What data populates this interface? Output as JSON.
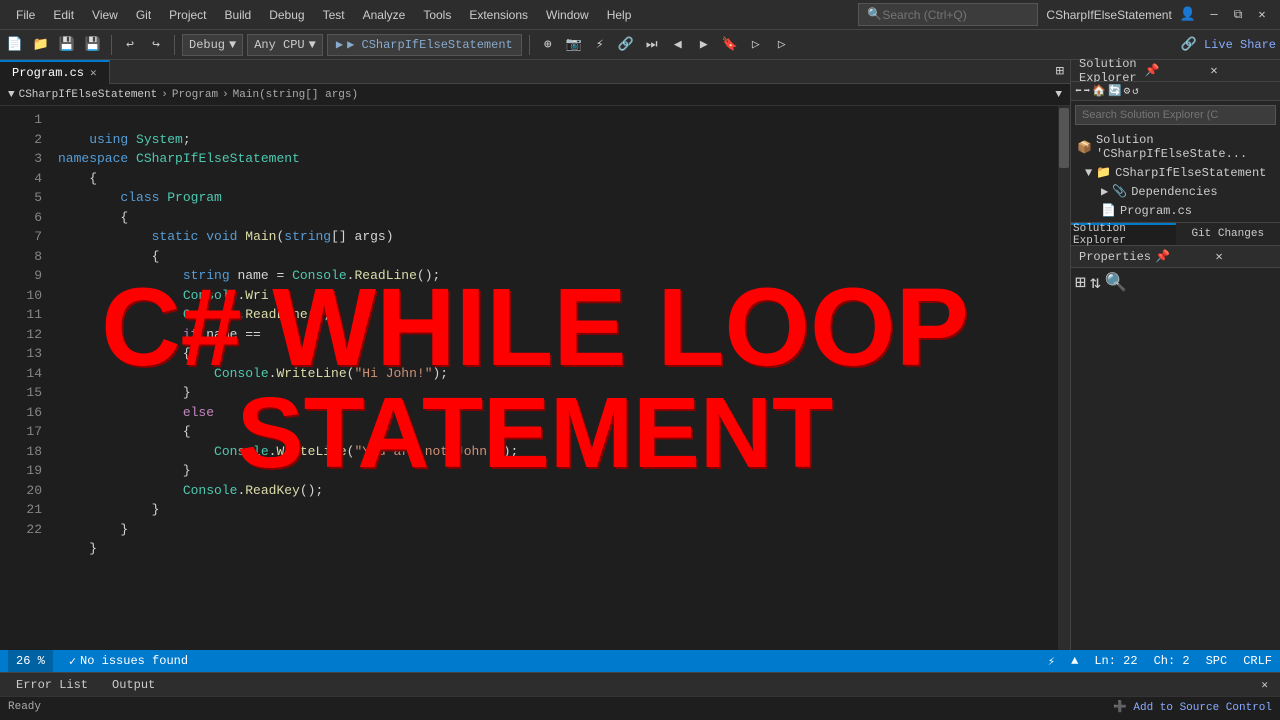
{
  "title_bar": {
    "menu_items": [
      "File",
      "Edit",
      "View",
      "Git",
      "Project",
      "Build",
      "Debug",
      "Test",
      "Analyze",
      "Tools",
      "Extensions",
      "Window",
      "Help"
    ],
    "search_placeholder": "Search (Ctrl+Q)",
    "window_title": "CSharpIfElseStatement",
    "user_icon": "👤"
  },
  "toolbar": {
    "config_dropdown": "Debug",
    "platform_dropdown": "Any CPU",
    "run_button": "▶ CSharpIfElseStatement",
    "live_share": "Live Share"
  },
  "editor": {
    "tab_name": "Program.cs",
    "breadcrumb": [
      "CSharpIfElseStatement",
      "Program",
      "Main(string[] args)"
    ],
    "lines": [
      {
        "num": 1,
        "code": "    using System;"
      },
      {
        "num": 2,
        "code": "namespace CSharpIfElseStatement"
      },
      {
        "num": 3,
        "code": "    {"
      },
      {
        "num": 4,
        "code": "        class Program"
      },
      {
        "num": 5,
        "code": "        {"
      },
      {
        "num": 6,
        "code": "            static void Main(string[] args)"
      },
      {
        "num": 7,
        "code": "            {"
      },
      {
        "num": 8,
        "code": "                string name = Console.ReadLine();"
      },
      {
        "num": 9,
        "code": "                Console.Write"
      },
      {
        "num": 10,
        "code": "                Console.ReadLine();"
      },
      {
        "num": 11,
        "code": "                if(name =="
      },
      {
        "num": 12,
        "code": "                {"
      },
      {
        "num": 13,
        "code": "                    Console.WriteLine(\"Hi John!\");"
      },
      {
        "num": 14,
        "code": "                }"
      },
      {
        "num": 15,
        "code": "                else"
      },
      {
        "num": 16,
        "code": "                {"
      },
      {
        "num": 17,
        "code": "                    Console.WriteLine(\"You are not John!\");"
      },
      {
        "num": 18,
        "code": "                }"
      },
      {
        "num": 19,
        "code": "                Console.ReadKey();"
      },
      {
        "num": 20,
        "code": "            }"
      },
      {
        "num": 21,
        "code": "        }"
      },
      {
        "num": 22,
        "code": "    }"
      }
    ],
    "overlay_line1": "C# WHILE LOOP",
    "overlay_line2": "STATEMENT"
  },
  "solution_explorer": {
    "title": "Solution Explorer",
    "search_placeholder": "Search Solution Explorer (C",
    "solution_name": "Solution 'CSharpIfElseState...",
    "project_name": "CSharpIfElseStatement",
    "nodes": [
      {
        "label": "Dependencies",
        "indent": 4
      },
      {
        "label": "Program.cs",
        "indent": 4
      }
    ],
    "tabs": [
      "Solution Explorer",
      "Git Changes"
    ]
  },
  "properties": {
    "title": "Properties"
  },
  "status_bar": {
    "zoom": "26 %",
    "issues_icon": "✓",
    "issues_text": "No issues found",
    "ln": "Ln: 22",
    "ch": "Ch: 2",
    "encoding": "SPC",
    "line_endings": "CRLF"
  },
  "bottom_tabs": {
    "tabs": [
      "Error List",
      "Output"
    ],
    "status": "Ready"
  }
}
